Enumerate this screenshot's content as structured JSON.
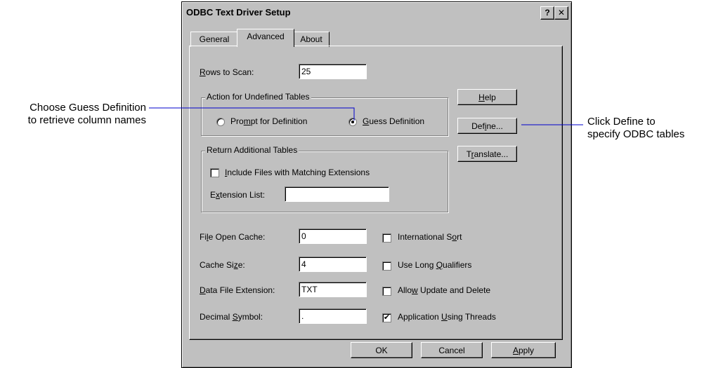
{
  "dialog": {
    "title": "ODBC Text Driver Setup",
    "help_glyph": "?",
    "close_glyph": "✕",
    "tabs": [
      {
        "label": "General"
      },
      {
        "label": "Advanced",
        "selected": true
      },
      {
        "label": "About"
      }
    ]
  },
  "advanced": {
    "rows_to_scan": {
      "label_pre": "",
      "label_mnemonic": "R",
      "label_post": "ows to Scan:",
      "value": "25"
    },
    "action_group": {
      "title": "Action for Undefined Tables",
      "prompt": {
        "pre": "Pro",
        "mnemonic": "m",
        "post": "pt for Definition",
        "selected": false
      },
      "guess": {
        "pre": "",
        "mnemonic": "G",
        "post": "uess Definition",
        "selected": true
      }
    },
    "return_group": {
      "title": "Return Additional Tables",
      "include": {
        "pre": "",
        "mnemonic": "I",
        "post": "nclude Files with Matching Extensions",
        "checked": false
      },
      "extension_list": {
        "pre": "E",
        "mnemonic": "x",
        "post": "tension List:",
        "value": ""
      }
    },
    "side_buttons": {
      "help": {
        "pre": "",
        "mnemonic": "H",
        "post": "elp"
      },
      "define": {
        "pre": "Def",
        "mnemonic": "i",
        "post": "ne..."
      },
      "translate": {
        "pre": "T",
        "mnemonic": "r",
        "post": "anslate..."
      }
    },
    "fields": {
      "file_open_cache": {
        "pre": "Fi",
        "mnemonic": "l",
        "post": "e Open Cache:",
        "value": "0"
      },
      "cache_size": {
        "pre": "Cache Si",
        "mnemonic": "z",
        "post": "e:",
        "value": "4"
      },
      "data_file_extension": {
        "pre": "",
        "mnemonic": "D",
        "post": "ata File Extension:",
        "value": "TXT"
      },
      "decimal_symbol": {
        "pre": "Decimal ",
        "mnemonic": "S",
        "post": "ymbol:",
        "value": "."
      }
    },
    "checkboxes": {
      "international_sort": {
        "pre": "International S",
        "mnemonic": "o",
        "post": "rt",
        "checked": false
      },
      "use_long_qualifiers": {
        "pre": "Use Long ",
        "mnemonic": "Q",
        "post": "ualifiers",
        "checked": false
      },
      "allow_update_delete": {
        "pre": "Allo",
        "mnemonic": "w",
        "post": " Update and Delete",
        "checked": false
      },
      "application_using_threads": {
        "pre": "Application ",
        "mnemonic": "U",
        "post": "sing Threads",
        "checked": true
      }
    }
  },
  "footer": {
    "ok": {
      "pre": "OK",
      "mnemonic": "",
      "post": ""
    },
    "cancel": {
      "pre": "Cancel",
      "mnemonic": "",
      "post": ""
    },
    "apply": {
      "pre": "",
      "mnemonic": "A",
      "post": "pply"
    }
  },
  "callouts": {
    "left": {
      "line1": "Choose Guess Definition",
      "line2": "to retrieve column names"
    },
    "right": {
      "line1": "Click Define to",
      "line2": "specify ODBC tables"
    }
  },
  "colors": {
    "callout_line": "#0000cc",
    "dialog_face": "#c0c0c0"
  },
  "check_glyph": "✔"
}
